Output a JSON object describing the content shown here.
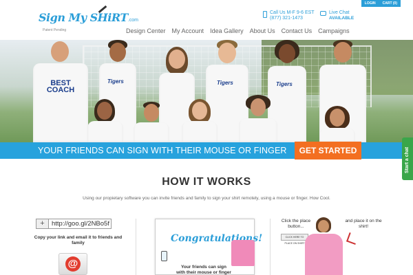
{
  "header": {
    "logo_text": "Sign My SHiRT",
    "logo_suffix": ".com",
    "logo_sub": "Patent Pending",
    "topbar": {
      "login": "LOGIN",
      "cart": "CART (0)"
    },
    "call": {
      "line1": "Call Us M-F 9-6 EST",
      "line2": "(877) 321-1473"
    },
    "chat": {
      "line1": "Live Chat",
      "line2": "AVAILABLE"
    },
    "nav": [
      "Design Center",
      "My Account",
      "Idea Gallery",
      "About Us",
      "Contact Us",
      "Campaigns"
    ]
  },
  "hero": {
    "coach_shirt": "BEST COACH",
    "team_shirt": "Tigers",
    "banner_text": "YOUR FRIENDS CAN SIGN WITH THEIR MOUSE OR FINGER",
    "cta_label": "GET STARTED"
  },
  "side_chat": "Start a chat",
  "how_it_works": {
    "title": "HOW IT WORKS",
    "subtitle": "Using our propietary software you can invite friends and family to sign your shirt remotely, using a mouse or finger. How Cool.",
    "step1": {
      "plus": "+",
      "url": "http://goo.gl/2NBo5f",
      "text": "Copy your link and email it to friends and family",
      "mail_symbol": "@"
    },
    "step2": {
      "headline": "Congratulations!",
      "text": "Your friends can sign with their mouse or finger"
    },
    "step3": {
      "left_text": "Click the place button...",
      "button_text": "CLICK HERE TO PLACE ON SHIRT",
      "right_text": "and place it on the shirt!"
    }
  },
  "colors": {
    "brand_blue": "#27a2dd",
    "cta_orange": "#f36f21",
    "chat_green": "#3aa64a"
  }
}
